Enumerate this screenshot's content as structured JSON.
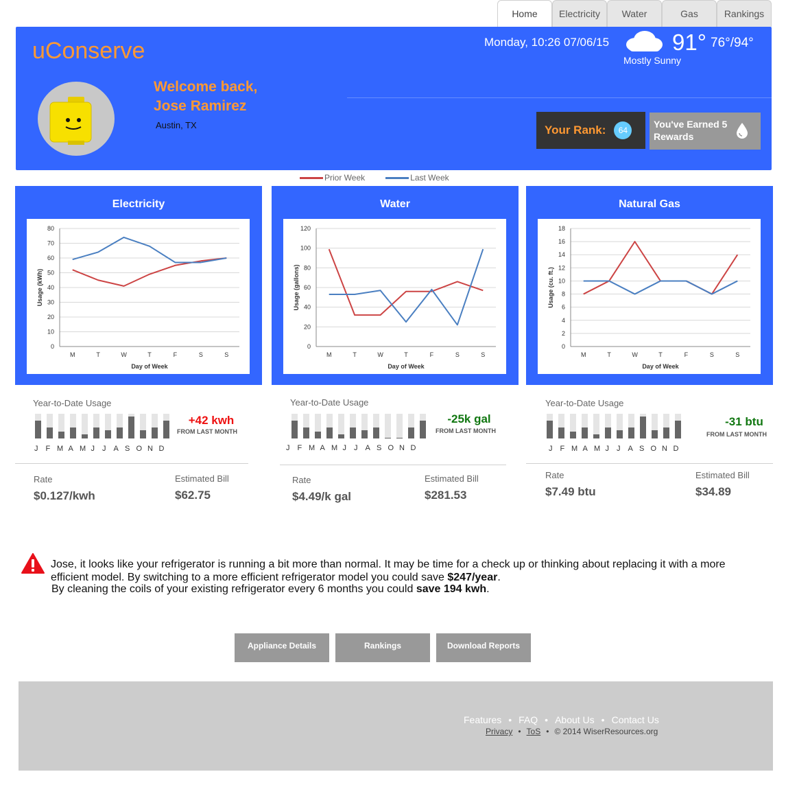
{
  "tabs": [
    "Home",
    "Electricity",
    "Water",
    "Gas",
    "Rankings"
  ],
  "header": {
    "logo": "uConserve",
    "welcome_line1": "Welcome back,",
    "welcome_line2": "Jose Ramirez",
    "location": "Austin, TX",
    "datetime": "Monday, 10:26 07/06/15",
    "temperature": "91°",
    "hi_lo": "76°/94°",
    "condition": "Mostly Sunny",
    "weather_icon": "cloud-icon",
    "rank_label": "Your Rank:",
    "rank_value": "64",
    "rewards_text": "You've Earned 5 Rewards",
    "rewards_icon": "water-drop-icon"
  },
  "legend": {
    "prior": "Prior Week",
    "last": "Last Week",
    "prior_color": "#cc4444",
    "last_color": "#4a7fc1"
  },
  "panels": [
    {
      "title": "Electricity",
      "chart_data": {
        "type": "line",
        "x": [
          "M",
          "T",
          "W",
          "T",
          "F",
          "S",
          "S"
        ],
        "xlabel": "Day of Week",
        "ylabel": "Usage (kWh)",
        "ylim": [
          0,
          80
        ],
        "yticks": [
          0,
          10,
          20,
          30,
          40,
          50,
          60,
          70,
          80
        ],
        "series": [
          {
            "name": "Prior Week",
            "values": [
              52,
              45,
              41,
              49,
              55,
              58,
              60
            ]
          },
          {
            "name": "Last Week",
            "values": [
              59,
              64,
              74,
              68,
              57,
              57,
              60
            ]
          }
        ]
      },
      "ytd_label": "Year-to-Date Usage",
      "ytd_values": [
        0.72,
        0.45,
        0.28,
        0.45,
        0.18,
        0.45,
        0.32,
        0.45,
        0.9,
        0.32,
        0.45,
        0.72
      ],
      "months": [
        "J",
        "F",
        "M",
        "A",
        "M",
        "J",
        "J",
        "A",
        "S",
        "O",
        "N",
        "D"
      ],
      "delta": "+42 kwh",
      "delta_color": "#ee1111",
      "delta_sub": "FROM LAST MONTH",
      "rate_label": "Rate",
      "rate_value": "$0.127/kwh",
      "bill_label": "Estimated Bill",
      "bill_value": "$62.75"
    },
    {
      "title": "Water",
      "chart_data": {
        "type": "line",
        "x": [
          "M",
          "T",
          "W",
          "T",
          "F",
          "S",
          "S"
        ],
        "xlabel": "Day of Week",
        "ylabel": "Usage (gallons)",
        "ylim": [
          0,
          120
        ],
        "yticks": [
          0,
          20,
          40,
          60,
          80,
          100,
          120
        ],
        "series": [
          {
            "name": "Prior Week",
            "values": [
              99,
              32,
              32,
              56,
              56,
              66,
              57
            ]
          },
          {
            "name": "Last Week",
            "values": [
              53,
              53,
              57,
              25,
              58,
              22,
              99
            ]
          }
        ]
      },
      "ytd_label": "Year-to-Date Usage",
      "ytd_values": [
        0.72,
        0.45,
        0.28,
        0.45,
        0.18,
        0.45,
        0.32,
        0.45,
        0.02,
        0.02,
        0.45,
        0.72
      ],
      "months": [
        "J",
        "F",
        "M",
        "A",
        "M",
        "J",
        "J",
        "A",
        "S",
        "O",
        "N",
        "D"
      ],
      "delta": "-25k gal",
      "delta_color": "#117711",
      "delta_sub": "FROM LAST MONTH",
      "rate_label": "Rate",
      "rate_value": "$4.49/k gal",
      "bill_label": "Estimated Bill",
      "bill_value": "$281.53"
    },
    {
      "title": "Natural Gas",
      "chart_data": {
        "type": "line",
        "x": [
          "M",
          "T",
          "W",
          "T",
          "F",
          "S",
          "S"
        ],
        "xlabel": "Day of Week",
        "ylabel": "Usage (cu. ft.)",
        "ylim": [
          0,
          18
        ],
        "yticks": [
          0,
          2,
          4,
          6,
          8,
          10,
          12,
          14,
          16,
          18
        ],
        "series": [
          {
            "name": "Prior Week",
            "values": [
              8,
              10,
              16,
              10,
              10,
              8,
              14
            ]
          },
          {
            "name": "Last Week",
            "values": [
              10,
              10,
              8,
              10,
              10,
              8,
              10
            ]
          }
        ]
      },
      "ytd_label": "Year-to-Date Usage",
      "ytd_values": [
        0.72,
        0.45,
        0.28,
        0.45,
        0.18,
        0.45,
        0.32,
        0.45,
        0.9,
        0.32,
        0.45,
        0.72
      ],
      "months": [
        "J",
        "F",
        "M",
        "A",
        "M",
        "J",
        "J",
        "A",
        "S",
        "O",
        "N",
        "D"
      ],
      "delta": "-31 btu",
      "delta_color": "#117711",
      "delta_sub": "FROM LAST MONTH",
      "rate_label": "Rate",
      "rate_value": "$7.49 btu",
      "bill_label": "Estimated Bill",
      "bill_value": "$34.89"
    }
  ],
  "alert": {
    "icon": "warning-icon",
    "text_part1": "Jose, it looks like your refrigerator is running a bit more than normal.  It may be time for a check up or thinking about replacing it with a more efficient model.  By switching to a more efficient refrigerator model you could save ",
    "text_bold1": "$247/year",
    "text_part2": ".",
    "line2_part1": "By cleaning the coils of your existing refrigerator every 6 months you could ",
    "line2_bold": "save 194 kwh",
    "line2_part2": "."
  },
  "buttons": [
    "Appliance Details",
    "Rankings",
    "Download Reports"
  ],
  "footer": {
    "links": [
      "Features",
      "FAQ",
      "About Us",
      "Contact Us"
    ],
    "privacy": "Privacy",
    "tos": "ToS",
    "copyright": "© 2014 WiserResources.org",
    "bullet": "•"
  }
}
